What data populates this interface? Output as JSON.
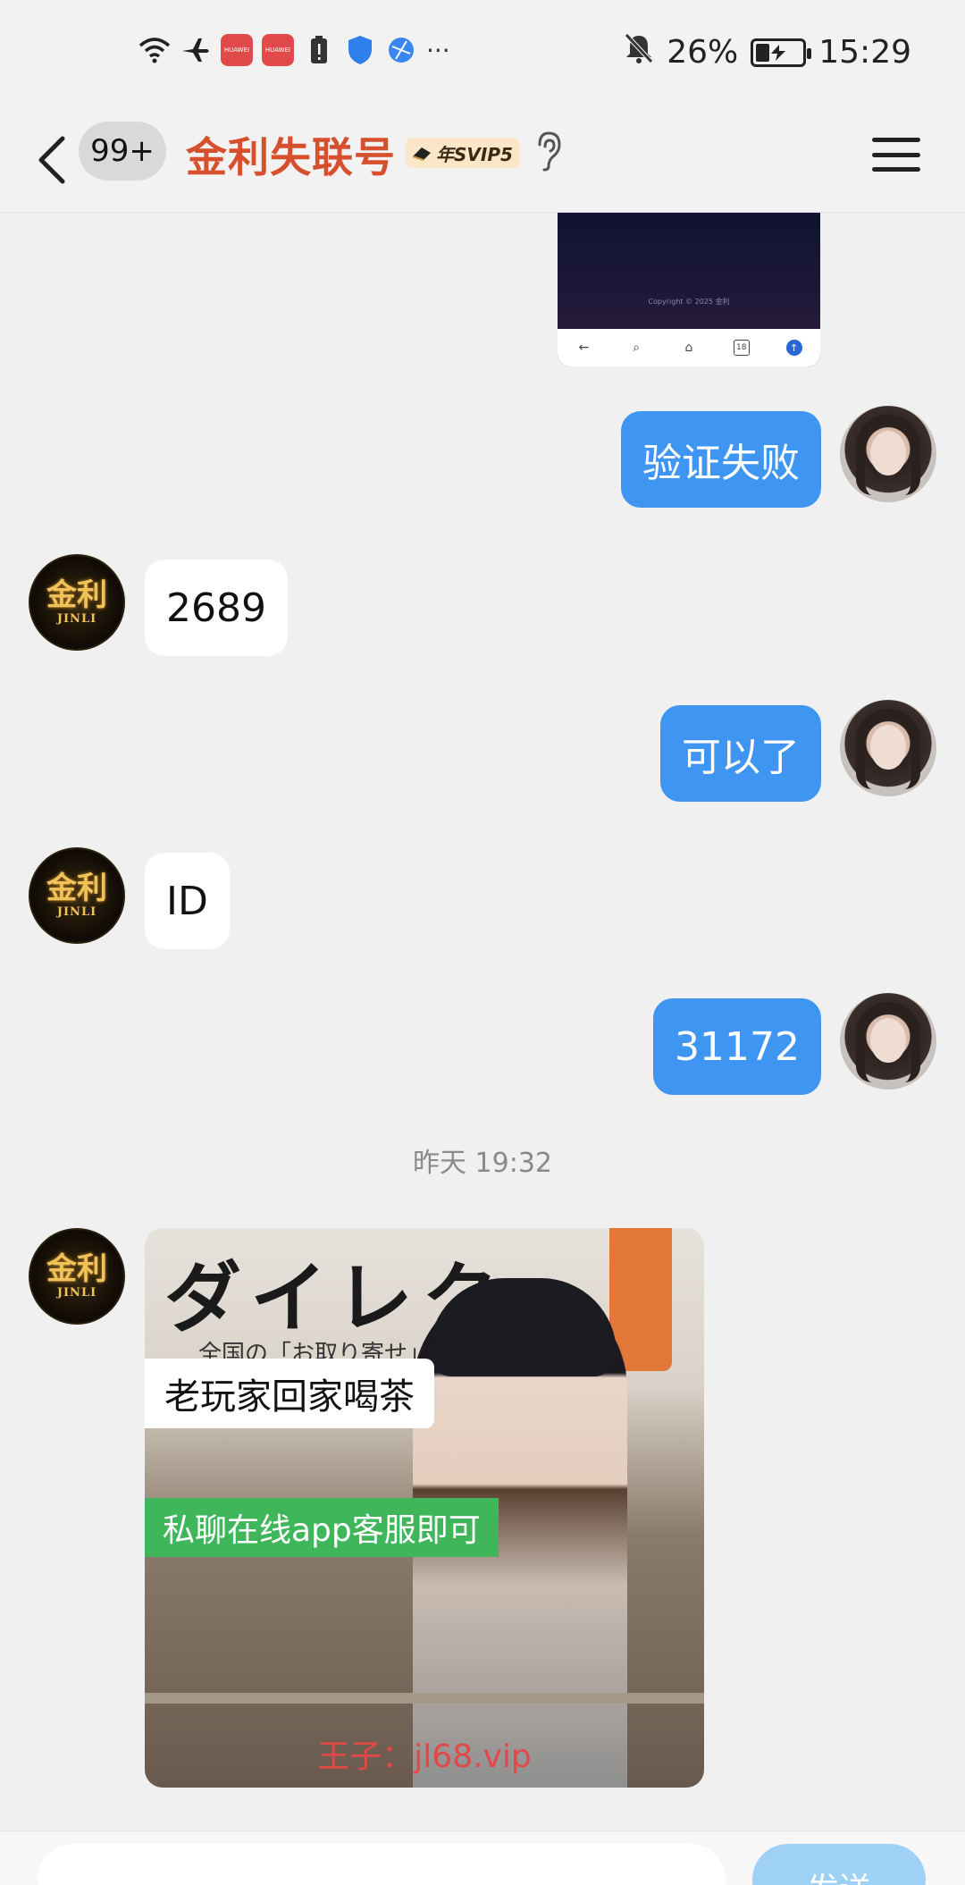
{
  "status_bar": {
    "battery_percent": "26%",
    "time": "15:29",
    "app_icon_label": "HUAWEI",
    "more_indicator": "···"
  },
  "header": {
    "unread_count": "99+",
    "title": "金利失联号",
    "vip_label": "年SVIP5"
  },
  "screenshot_preview": {
    "copyright": "Copyright © 2025 金利"
  },
  "messages": [
    {
      "from": "me",
      "text": "验证失败"
    },
    {
      "from": "other",
      "text": "2689"
    },
    {
      "from": "me",
      "text": "可以了"
    },
    {
      "from": "other",
      "text": "ID"
    },
    {
      "from": "me",
      "text": "31172"
    }
  ],
  "timestamp": "昨天 19:32",
  "contact_avatar": {
    "line1": "金利",
    "line2": "JINLI"
  },
  "promo_image": {
    "kana_heading": "ダイレク",
    "subtext": "全国の「お取り寄せ」",
    "label_1": "老玩家回家喝茶",
    "label_2": "私聊在线app客服即可",
    "url_line": "王子：jl68.vip"
  },
  "input": {
    "send_label": "发送"
  },
  "colors": {
    "outgoing_bubble": "#3f95f2",
    "incoming_bubble": "#ffffff",
    "title": "#d6502d",
    "send_button": "#9fd0f6"
  }
}
